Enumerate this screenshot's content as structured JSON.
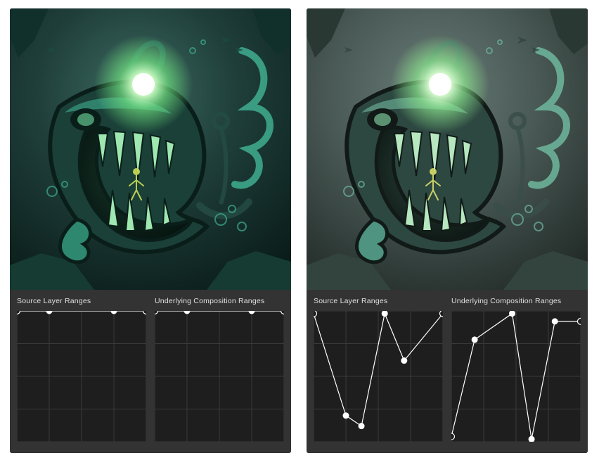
{
  "panels": [
    {
      "id": "left",
      "artwork_name": "anglerfish-illustration",
      "filter": "none",
      "graphs": {
        "source": {
          "label": "Source Layer Ranges",
          "points": [
            {
              "x": 0.0,
              "y": 0.0
            },
            {
              "x": 0.25,
              "y": 0.0
            },
            {
              "x": 0.75,
              "y": 0.0
            },
            {
              "x": 1.0,
              "y": 0.0
            }
          ]
        },
        "underlying": {
          "label": "Underlying Composition Ranges",
          "points": [
            {
              "x": 0.0,
              "y": 0.0
            },
            {
              "x": 0.25,
              "y": 0.0
            },
            {
              "x": 0.75,
              "y": 0.0
            },
            {
              "x": 1.0,
              "y": 0.0
            }
          ]
        }
      }
    },
    {
      "id": "right",
      "artwork_name": "anglerfish-illustration",
      "filter": "desaturate",
      "graphs": {
        "source": {
          "label": "Source Layer Ranges",
          "points": [
            {
              "x": 0.0,
              "y": 0.02
            },
            {
              "x": 0.25,
              "y": 0.8
            },
            {
              "x": 0.37,
              "y": 0.88
            },
            {
              "x": 0.55,
              "y": 0.02
            },
            {
              "x": 0.7,
              "y": 0.38
            },
            {
              "x": 1.0,
              "y": 0.02
            }
          ]
        },
        "underlying": {
          "label": "Underlying Composition Ranges",
          "points": [
            {
              "x": 0.0,
              "y": 0.96
            },
            {
              "x": 0.18,
              "y": 0.22
            },
            {
              "x": 0.47,
              "y": 0.02
            },
            {
              "x": 0.62,
              "y": 0.98
            },
            {
              "x": 0.8,
              "y": 0.08
            },
            {
              "x": 1.0,
              "y": 0.08
            }
          ]
        }
      }
    }
  ],
  "colors": {
    "panel_bg": "#333333",
    "graph_bg": "#1e1e1e",
    "grid": "#3a3a3a",
    "curve": "#ffffff",
    "label": "#e0e0e0"
  }
}
